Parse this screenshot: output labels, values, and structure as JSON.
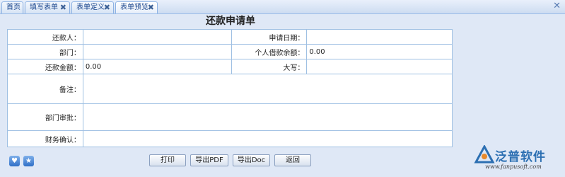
{
  "tabs": [
    {
      "label": "首页",
      "closable": false,
      "active": false
    },
    {
      "label": "填写表单",
      "closable": true,
      "active": false
    },
    {
      "label": "表单定义",
      "closable": true,
      "active": false
    },
    {
      "label": "表单预览",
      "closable": true,
      "active": true
    }
  ],
  "close_glyph": "✖",
  "window_close_glyph": "✕",
  "form": {
    "title": "还款申请单",
    "rows": {
      "repayer": {
        "label": "还款人：",
        "value": ""
      },
      "apply_date": {
        "label": "申请日期：",
        "value": ""
      },
      "department": {
        "label": "部门：",
        "value": ""
      },
      "personal_loan_balance": {
        "label": "个人借款余额：",
        "value": "0.00"
      },
      "repay_amount": {
        "label": "还款金额：",
        "value": "0.00"
      },
      "amount_uppercase": {
        "label": "大写：",
        "value": ""
      },
      "remarks": {
        "label": "备注：",
        "value": ""
      },
      "dept_approval": {
        "label": "部门审批：",
        "value": ""
      },
      "finance_confirm": {
        "label": "财务确认：",
        "value": ""
      }
    }
  },
  "buttons": {
    "print": "打印",
    "export_pdf": "导出PDF",
    "export_doc": "导出Doc",
    "back": "返回"
  },
  "footer_icons": [
    "heart-icon",
    "star-icon"
  ],
  "logo": {
    "name": "泛普软件",
    "url": "www.fanpusoft.com"
  },
  "colors": {
    "accent": "#15428b",
    "border": "#9fc0e3",
    "background": "#dfe8f6",
    "logo": "#2c6fb2"
  }
}
